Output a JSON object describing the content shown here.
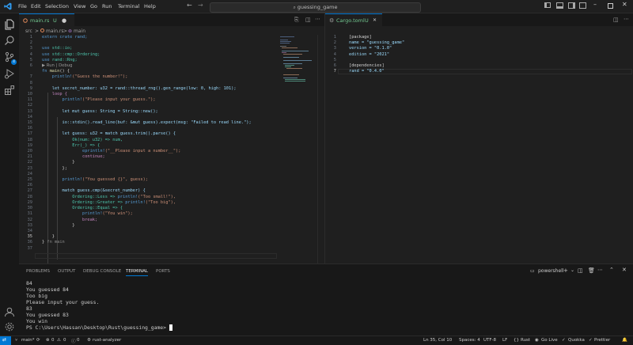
{
  "menu": [
    "File",
    "Edit",
    "Selection",
    "View",
    "Go",
    "Run",
    "Terminal",
    "Help"
  ],
  "search": {
    "text": "guessing_game"
  },
  "colors": {
    "accent": "#0078d4",
    "modified": "#73c991",
    "bg": "#1f1f1f",
    "sidebar": "#181818"
  },
  "editor_left": {
    "tab": {
      "name": "main.rs",
      "status": "U"
    },
    "breadcrumb": [
      "src",
      ">",
      "main.rs",
      ">",
      "main"
    ],
    "codelens": "▶ Run | Debug",
    "lines": [
      "1",
      "2",
      "3",
      "4",
      "5",
      "6",
      "7",
      "8",
      "9",
      "10",
      "11",
      "12",
      "13",
      "14",
      "15",
      "16",
      "17",
      "18",
      "19",
      "20",
      "21",
      "22",
      "23",
      "24",
      "25",
      "26",
      "27",
      "28",
      "29",
      "30",
      "31",
      "32",
      "33",
      "34",
      "35",
      "36",
      "37"
    ],
    "code": {
      "l1": "extern crate rand;",
      "l3a": "use ",
      "l3b": "std::io;",
      "l4a": "use ",
      "l4b": "std::cmp::Ordering;",
      "l5a": "use ",
      "l5b": "rand::Rng;",
      "l7a": "fn ",
      "l7b": "main",
      "l7c": "() {",
      "l8a": "println!",
      "l8b": "(\"Guess the number!\");",
      "l10": "let secret_number: u32 = rand::thread_rng().gen_range(low: 0, high: 101);",
      "l11": "loop {",
      "l12a": "println!",
      "l12b": "(\"Please input your guess.\");",
      "l14": "let mut guess: String = String::new();",
      "l16": "io::stdin().read_line(buf: &mut guess).expect(msg: \"Failed to read line.\");",
      "l18": "let guess: u32 = match guess.trim().parse() {",
      "l19": "Ok(num: u32) => num,",
      "l20": "Err(_) => {",
      "l21a": "eprintln!",
      "l21b": "(\"__Please input a number__\");",
      "l22": "continue;",
      "l23": "}",
      "l24": "};",
      "l26a": "println!",
      "l26b": "(\"You guessed {}\", guess);",
      "l28": "match guess.cmp(&secret_number) {",
      "l29a": "Ordering::Less => ",
      "l29b": "println!",
      "l29c": "(\"Too small!\"),",
      "l30a": "Ordering::Greater => ",
      "l30b": "println!",
      "l30c": "(\"Too big\"),",
      "l31": "Ordering::Equal => {",
      "l32a": "println!",
      "l32b": "(\"You win\");",
      "l33": "break;",
      "l34": "}",
      "l36": "}",
      "l37a": "}",
      "l37b": " fn main"
    }
  },
  "editor_right": {
    "tab": {
      "name": "Cargo.toml",
      "status": "U"
    },
    "lines": [
      "1",
      "2",
      "3",
      "4",
      "5",
      "6",
      "7"
    ],
    "toml": [
      "[package]",
      "name = \"guessing_game\"",
      "version = \"0.1.0\"",
      "edition = \"2021\"",
      "",
      "[dependencies]",
      "rand = \"0.4.0\""
    ]
  },
  "panel": {
    "tabs": [
      "PROBLEMS",
      "OUTPUT",
      "DEBUG CONSOLE",
      "TERMINAL",
      "PORTS"
    ],
    "active_tab": "TERMINAL",
    "shell": "powershell",
    "terminal": [
      "84",
      "You guessed 84",
      "Too big",
      "Please input your guess.",
      "83",
      "You guessed 83",
      "You win",
      "PS C:\\Users\\Hassan\\Desktop\\Rust\\guessing_game> "
    ]
  },
  "status": {
    "branch": "main*",
    "errors": "0",
    "warnings": "0",
    "info": "0",
    "analyzer": "rust-analyzer",
    "position": "Ln 35, Col 10",
    "spaces": "Spaces: 4",
    "encoding": "UTF-8",
    "eol": "LF",
    "language": "Rust",
    "golive": "Go Live",
    "quokka": "Quokka",
    "prettier": "Prettier"
  }
}
